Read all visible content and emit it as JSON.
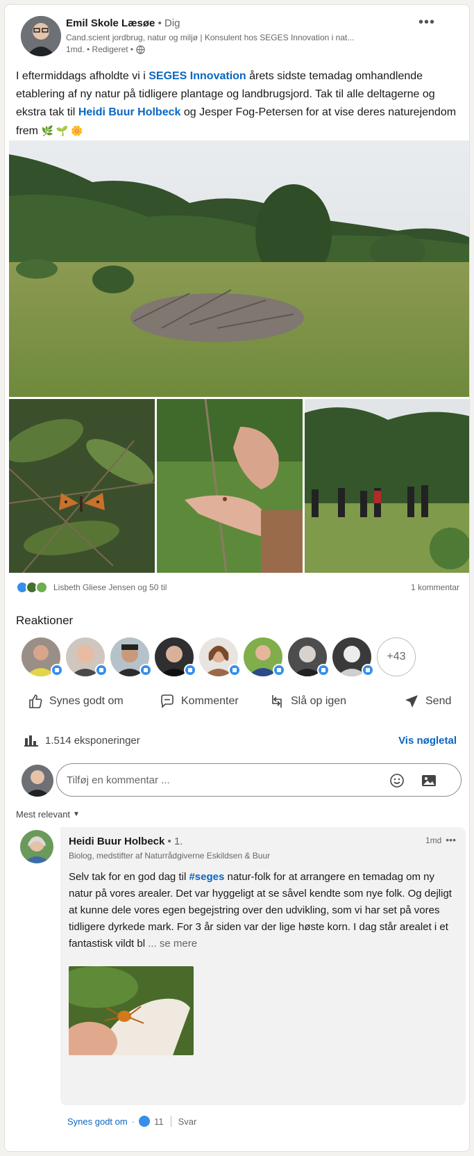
{
  "post": {
    "author": {
      "name": "Emil Skole Læsøe",
      "degree": "• Dig",
      "headline": "Cand.scient jordbrug, natur og miljø | Konsulent hos SEGES Innovation i nat...",
      "time": "1md. • Redigeret •"
    },
    "menu_dots": "•••",
    "text": {
      "p1": "I eftermiddags afholdte vi i ",
      "mention1": "SEGES Innovation",
      "p2": " årets sidste temadag omhandlende etablering af ny natur på tidligere plantage og landbrugsjord. Tak til alle deltagerne og ekstra tak til ",
      "mention2": "Heidi Buur Holbeck",
      "p3": " og Jesper Fog-Petersen for at vise deres naturejendom frem",
      "emoji": "🌿 🌱 🌼"
    }
  },
  "social": {
    "reactors": "Lisbeth Gliese Jensen og 50 til",
    "comments": "1 kommentar"
  },
  "reactions": {
    "heading": "Reaktioner",
    "more": "+43"
  },
  "actions": {
    "like": "Synes godt om",
    "comment": "Kommenter",
    "repost": "Slå op igen",
    "send": "Send"
  },
  "analytics": {
    "impressions": "1.514 eksponeringer",
    "view": "Vis nøgletal"
  },
  "comment_box": {
    "placeholder": "Tilføj en kommentar ..."
  },
  "sort": {
    "label": "Mest relevant"
  },
  "reply": {
    "name": "Heidi Buur Holbeck",
    "degree": "• 1.",
    "headline": "Biolog, medstifter af Naturrådgiverne Eskildsen & Buur",
    "time": "1md",
    "dots": "•••",
    "text_before": "Selv tak for en god dag til ",
    "hashtag": "#seges",
    "text_after": " natur-folk for at arrangere en temadag om ny natur på vores arealer. Det var hyggeligt at se såvel kendte som nye folk. Og dejligt at kunne dele vores egen begejstring over den udvikling, som vi har set på vores tidligere dyrkede mark. For 3 år siden var der lige høste korn. I dag står arealet i et fantastisk vildt bl",
    "see_more": "... se mere",
    "like_label": "Synes godt om",
    "like_count": "11",
    "reply_label": "Svar"
  },
  "colors": {
    "link": "#0a66c2",
    "like_blue": "#378fe9"
  }
}
